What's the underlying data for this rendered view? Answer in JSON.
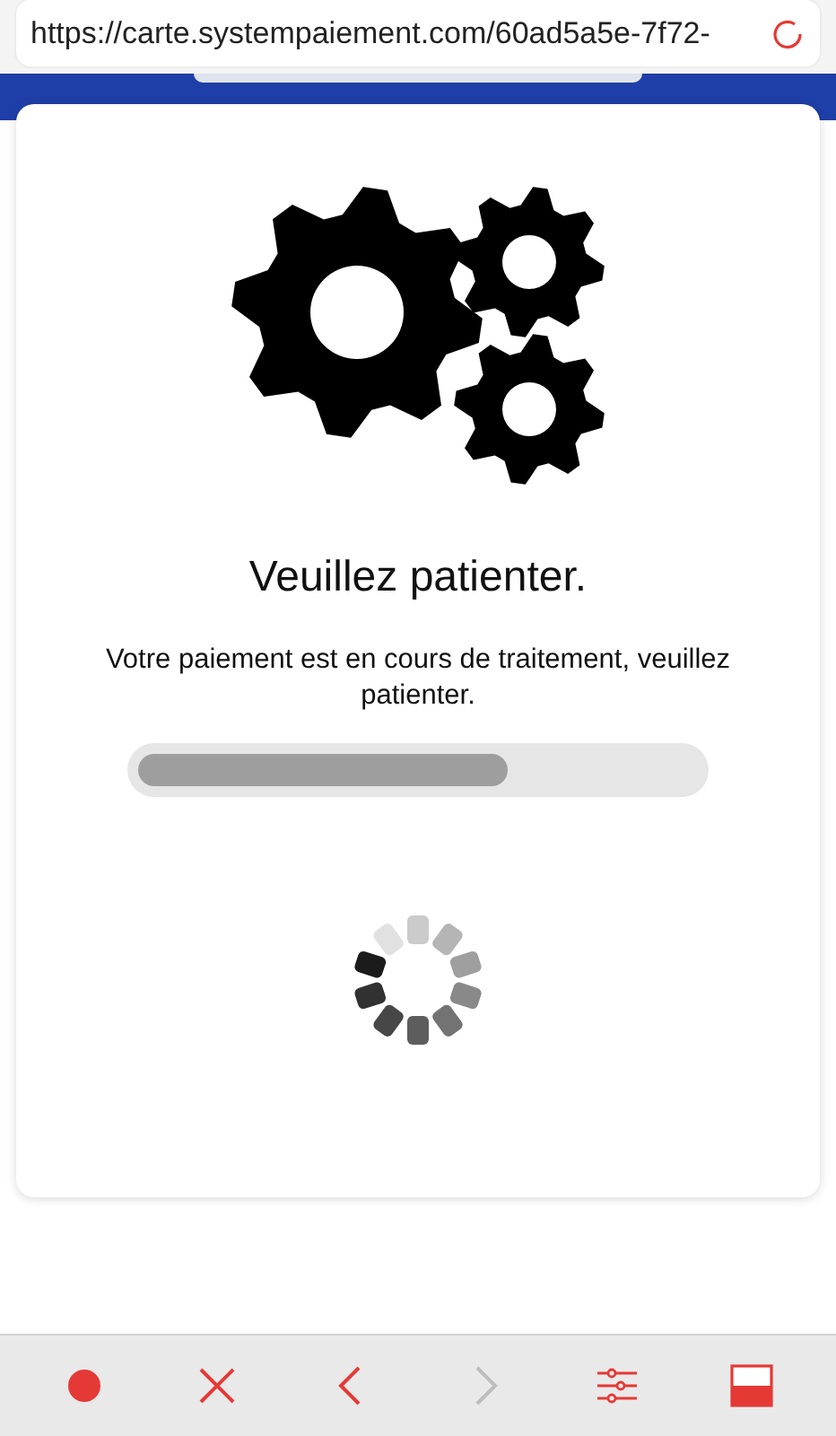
{
  "address_bar": {
    "url": "https://carte.systempaiement.com/60ad5a5e-7f72-"
  },
  "content": {
    "heading": "Veuillez patienter.",
    "message": "Votre paiement est en cours de traitement, veuillez patienter.",
    "progress": {
      "level": 0.66
    }
  },
  "toolbar": [
    {
      "kind": "record",
      "disabled": false
    },
    {
      "kind": "close",
      "disabled": false
    },
    {
      "kind": "back",
      "disabled": false
    },
    {
      "kind": "forward",
      "disabled": true
    },
    {
      "kind": "settings",
      "disabled": false
    },
    {
      "kind": "panel",
      "disabled": false
    }
  ]
}
